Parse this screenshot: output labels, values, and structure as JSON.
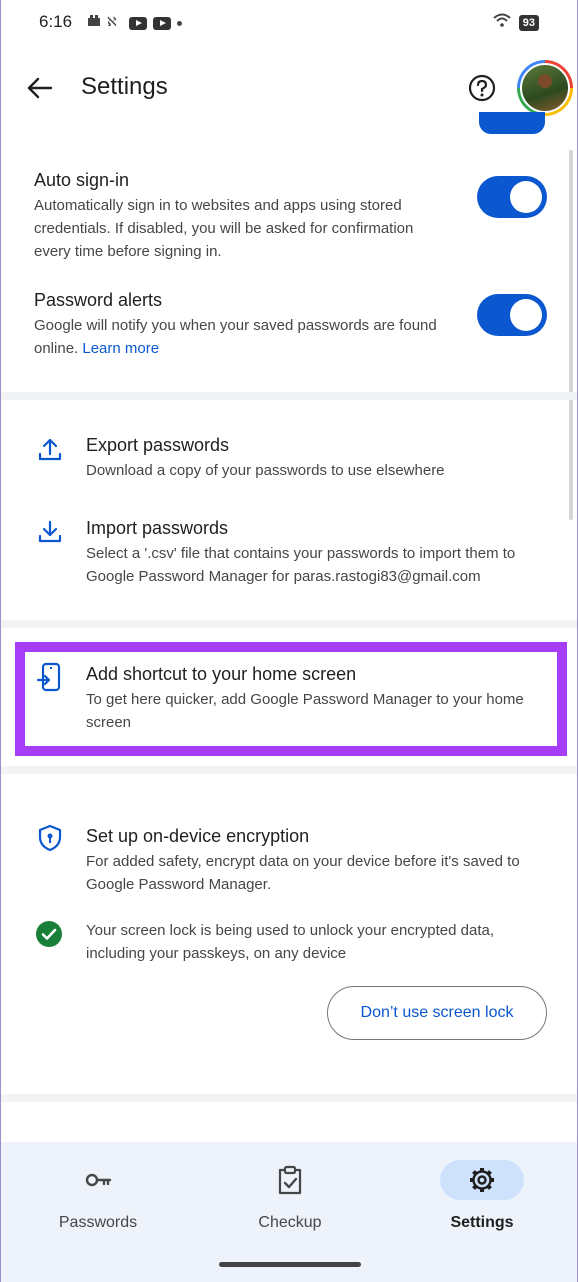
{
  "status_bar": {
    "time": "6:16",
    "battery": "93",
    "icons": [
      "notification-icon",
      "app-notification-icon",
      "youtube-icon",
      "youtube-icon",
      "dot-icon",
      "wifi-icon",
      "battery-icon"
    ]
  },
  "app_bar": {
    "title": "Settings",
    "icons": [
      "back-arrow-icon",
      "help-icon",
      "avatar"
    ]
  },
  "auto_sign_in": {
    "title": "Auto sign-in",
    "description": "Automatically sign in to websites and apps using stored credentials. If disabled, you will be asked for confirmation every time before signing in.",
    "enabled": true
  },
  "password_alerts": {
    "title": "Password alerts",
    "description": "Google will notify you when your saved passwords are found online.",
    "link": "Learn more",
    "enabled": true
  },
  "export_passwords": {
    "title": "Export passwords",
    "description": "Download a copy of your passwords to use elsewhere"
  },
  "import_passwords": {
    "title": "Import passwords",
    "description": "Select a '.csv' file that contains your passwords to import them to Google Password Manager for paras.rastogi83@gmail.com"
  },
  "add_shortcut": {
    "title": "Add shortcut to your home screen",
    "description": "To get here quicker, add Google Password Manager to your home screen"
  },
  "encryption": {
    "title": "Set up on-device encryption",
    "description": "For added safety, encrypt data on your device before it's saved to Google Password Manager.",
    "status": "Your screen lock is being used to unlock your encrypted data, including your passkeys, on any device",
    "button": "Don’t use screen lock"
  },
  "bottom_nav": {
    "items": [
      {
        "label": "Passwords",
        "icon": "key-icon",
        "active": false
      },
      {
        "label": "Checkup",
        "icon": "clipboard-check-icon",
        "active": false
      },
      {
        "label": "Settings",
        "icon": "gear-icon",
        "active": true
      }
    ]
  },
  "colors": {
    "accent": "#0b57d0",
    "highlight": "#a63ef8",
    "success": "#188038",
    "nav_bg": "#eef2fa"
  }
}
